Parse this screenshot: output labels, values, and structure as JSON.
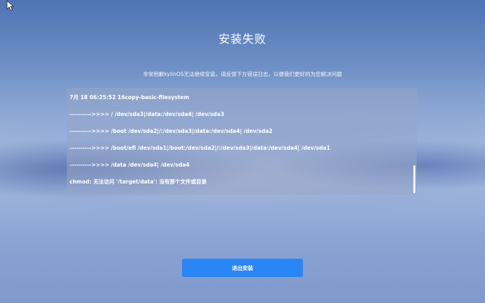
{
  "page": {
    "title": "安装失败",
    "subtitle": "非常抱歉kylinOS无法继续安装，请反馈下方错误日志，以便我们更好的为您解决问题"
  },
  "log": {
    "lines": [
      "7月 18 06:25:52 16copy-basic-filesystem",
      "---------->>>> / /dev/sda3|/data:/dev/sda4| /dev/sda3",
      "---------->>>> /boot /dev/sda2|/:/dev/sda3|/data:/dev/sda4| /dev/sda2",
      "---------->>>> /boot/efi /dev/sda1|/boot:/dev/sda2|/:/dev/sda3|/data:/dev/sda4| /dev/sda1",
      "---------->>>> /data /dev/sda4| /dev/sda4",
      "chmod: 无法访问 '/target/data': 没有那个文件或目录"
    ]
  },
  "actions": {
    "exit_label": "退出安装"
  },
  "colors": {
    "accent": "#2b86f5",
    "text": "#ffffff"
  },
  "icons": {
    "cursor": "mouse-pointer-icon"
  }
}
